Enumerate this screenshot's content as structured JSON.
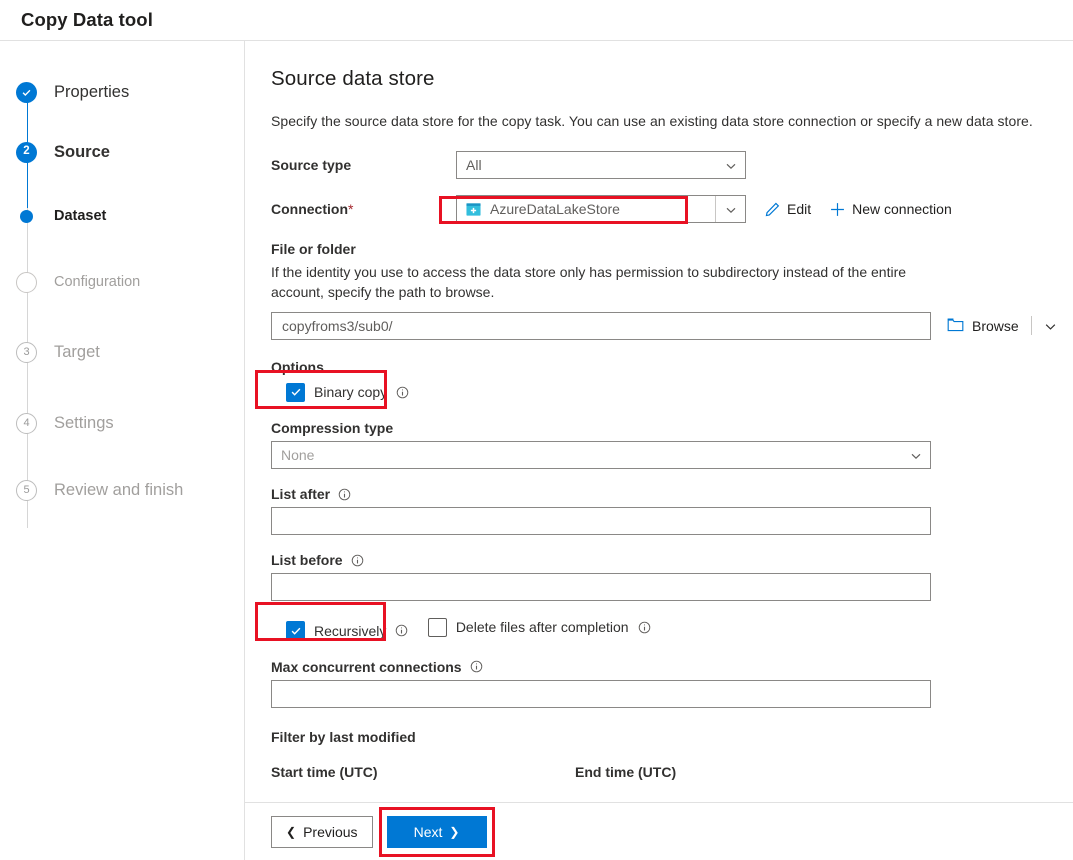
{
  "header": {
    "title": "Copy Data tool"
  },
  "sidebar": {
    "steps": [
      {
        "label": "Properties",
        "marker": "check",
        "state": "done"
      },
      {
        "label": "Source",
        "marker": "2",
        "state": "current"
      },
      {
        "label": "Dataset",
        "marker": "dot",
        "state": "active-sub"
      },
      {
        "label": "Configuration",
        "marker": "circle",
        "state": "disabled-sub"
      },
      {
        "label": "Target",
        "marker": "3",
        "state": "disabled"
      },
      {
        "label": "Settings",
        "marker": "4",
        "state": "disabled"
      },
      {
        "label": "Review and finish",
        "marker": "5",
        "state": "disabled"
      }
    ]
  },
  "main": {
    "page_title": "Source data store",
    "description": "Specify the source data store for the copy task. You can use an existing data store connection or specify a new data store.",
    "source_type": {
      "label": "Source type",
      "value": "All"
    },
    "connection": {
      "label": "Connection",
      "required_mark": "*",
      "value": "AzureDataLakeStore",
      "icon": "azure-data-lake-store-icon",
      "edit_label": "Edit",
      "new_connection_label": "New connection"
    },
    "file_or_folder": {
      "label": "File or folder",
      "help": "If the identity you use to access the data store only has permission to subdirectory instead of the entire account, specify the path to browse.",
      "value": "copyfroms3/sub0/",
      "browse_label": "Browse"
    },
    "options": {
      "label": "Options",
      "binary_copy": {
        "label": "Binary copy",
        "checked": true,
        "info": "info-icon"
      }
    },
    "compression": {
      "label": "Compression type",
      "value": "None"
    },
    "list_after": {
      "label": "List after",
      "value": ""
    },
    "list_before": {
      "label": "List before",
      "value": ""
    },
    "recursively": {
      "label": "Recursively",
      "checked": true
    },
    "delete_files": {
      "label": "Delete files after completion",
      "checked": false
    },
    "max_concurrent": {
      "label": "Max concurrent connections",
      "value": ""
    },
    "filter_by_last_modified": {
      "label": "Filter by last modified",
      "start_time_label": "Start time (UTC)",
      "end_time_label": "End time (UTC)"
    }
  },
  "footer": {
    "previous_label": "Previous",
    "next_label": "Next"
  },
  "colors": {
    "accent": "#0078d4",
    "highlight": "#e81123",
    "required": "#a4262c"
  }
}
